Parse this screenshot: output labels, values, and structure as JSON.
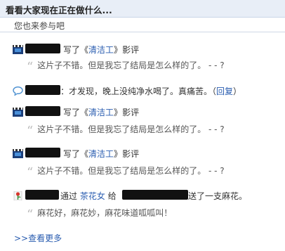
{
  "header": {
    "title": "看看大家现在正在做什么..."
  },
  "subheader": {
    "text": "您也来参与吧"
  },
  "feed": [
    {
      "type": "movie",
      "action": "写了",
      "open_q": "《",
      "link": "清洁工",
      "close_q": "》",
      "suffix": "影评",
      "quote": "这片子不错。但是我忘了结局是怎么样的了。 - - ?"
    },
    {
      "type": "status",
      "text": "：才发现，晚上没纯净水喝了。真痛苦。",
      "reply_open": "（",
      "reply": "回复",
      "reply_close": "）"
    },
    {
      "type": "movie",
      "action": "写了",
      "open_q": "《",
      "link": "清洁工",
      "close_q": "》",
      "suffix": "影评",
      "quote": "这片子不错。但是我忘了结局是怎么样的了。 - - ?"
    },
    {
      "type": "movie",
      "action": "写了",
      "open_q": "《",
      "link": "清洁工",
      "close_q": "》",
      "suffix": "影评",
      "quote": "这片子不错。但是我忘了结局是怎么样的了。 - - ?"
    },
    {
      "type": "flower",
      "pre": "通过",
      "link": "茶花女",
      "mid": "给",
      "post": "送了一支麻花。",
      "quote": "麻花好，麻花妙，麻花味道呱呱叫！"
    }
  ],
  "footer": {
    "more_label": ">>查看更多"
  },
  "colors": {
    "link": "#2a5db0",
    "header_bg": "#e8eef7"
  },
  "icons": [
    "film-icon",
    "chat-bubble-icon",
    "film-icon",
    "film-icon",
    "flower-icon"
  ]
}
